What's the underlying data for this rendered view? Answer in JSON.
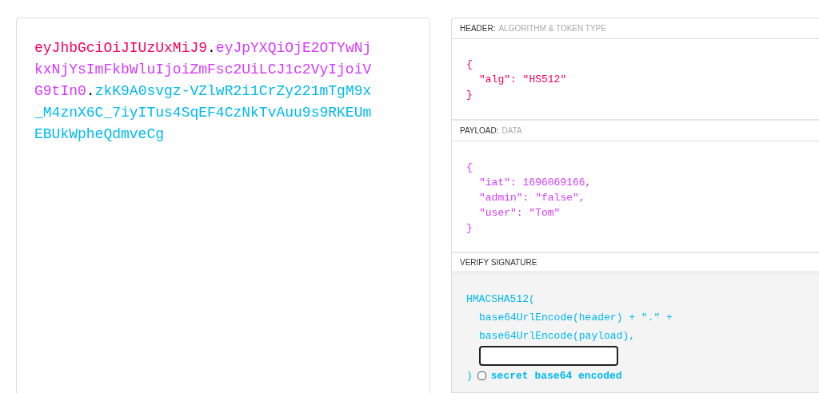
{
  "token": [
    {
      "text": "eyJhbGciOiJIUzUxMiJ9",
      "kind": "header"
    },
    {
      "text": ".",
      "kind": "separator"
    },
    {
      "text": "eyJpYXQiOjE2OTYwNjkxNjYsImFkbWluIjoiZmFsc2UiLCJ1c2VyIjoiVG9tIn0",
      "kind": "payload"
    },
    {
      "text": ".",
      "kind": "separator"
    },
    {
      "text": "zkK9A0svgz-VZlwR2i1CrZy221mTgM9x_M4znX6C_7iyITus4SqEF4CzNkTvAuu9s9RKEUmEBUkWpheQdmveCg",
      "kind": "signature"
    }
  ],
  "header": {
    "label": "HEADER:",
    "sublabel": "ALGORITHM & TOKEN TYPE",
    "open": "{",
    "entries": [
      "\"alg\": \"HS512\""
    ],
    "close": "}"
  },
  "payload": {
    "label": "PAYLOAD:",
    "sublabel": "DATA",
    "open": "{",
    "entries": [
      "\"iat\": 1696069166,",
      "\"admin\": \"false\",",
      "\"user\": \"Tom\""
    ],
    "close": "}"
  },
  "verify": {
    "label": "VERIFY SIGNATURE",
    "function": "HMACSHA512(",
    "args": [
      "base64UrlEncode(header) + \".\" +",
      "base64UrlEncode(payload),"
    ],
    "close": ")",
    "checkbox": {
      "label": "secret base64 encoded",
      "checked": false
    }
  }
}
